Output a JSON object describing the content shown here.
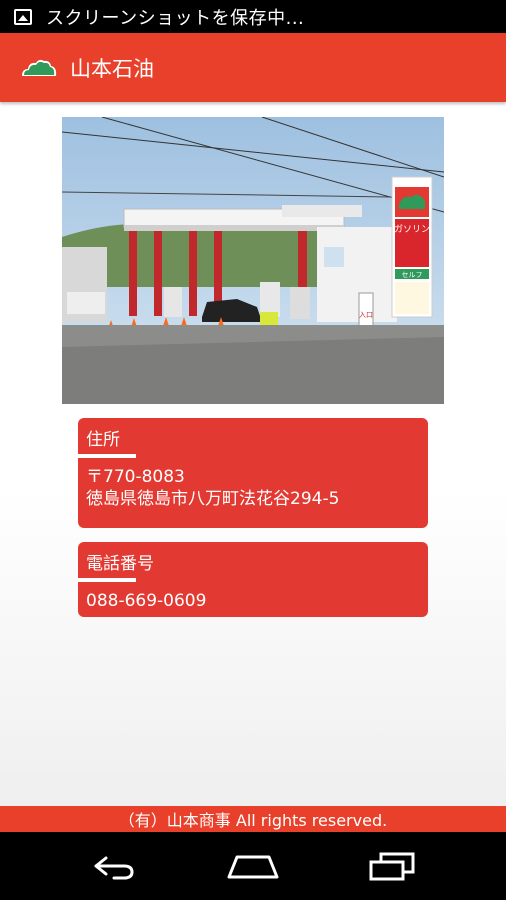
{
  "status_bar": {
    "text": "スクリーンショットを保存中..."
  },
  "app_bar": {
    "title": "山本石油"
  },
  "address_card": {
    "heading": "住所",
    "postal": "〒770-8083",
    "address": "徳島県徳島市八万町法花谷294-5"
  },
  "phone_card": {
    "heading": "電話番号",
    "phone": "088-669-0609"
  },
  "photo": {
    "sign_text": "ガソリン",
    "self_text": "セルフ",
    "entrance_text": "入口"
  },
  "footer": {
    "copyright": "（有）山本商事 All rights reserved."
  },
  "colors": {
    "accent": "#e8402a",
    "card": "#e23a33",
    "logo_green": "#2f9a5a"
  },
  "icons": {
    "status": "image-icon",
    "logo": "mountain-logo-icon",
    "nav_back": "back-icon",
    "nav_home": "home-icon",
    "nav_recents": "recents-icon"
  }
}
